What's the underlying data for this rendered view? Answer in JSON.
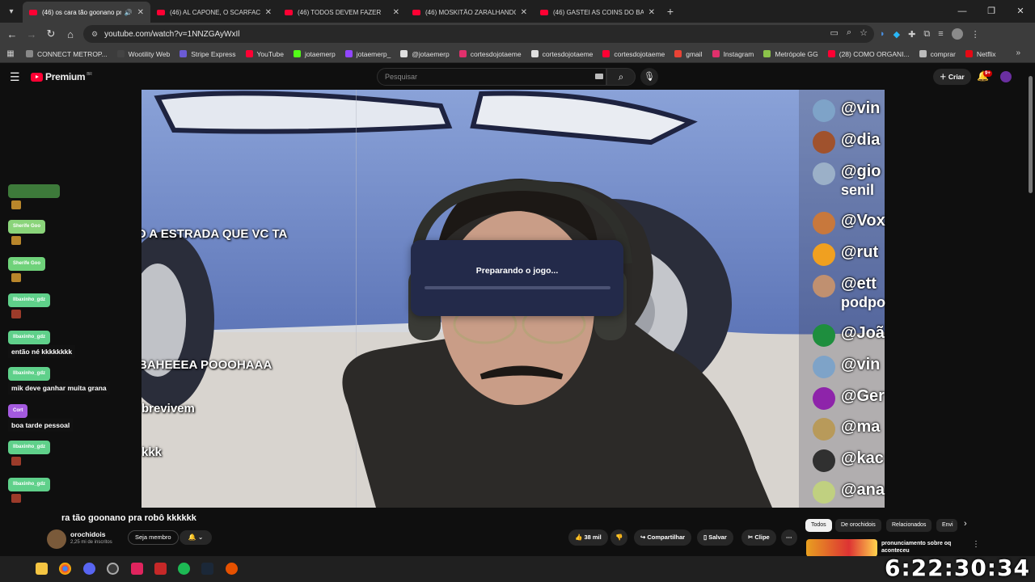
{
  "browser": {
    "tabs": [
      {
        "title": "(46) os cara tão goonano pr",
        "active": true
      },
      {
        "title": "(46) AL CAPONE, O SCARFACE",
        "active": false
      },
      {
        "title": "(46)  TODOS DEVEM FAZER",
        "active": false
      },
      {
        "title": "(46) MOSKITÃO ZARALHANDO",
        "active": false
      },
      {
        "title": "(46) GASTEI AS COINS DO BAN",
        "active": false
      }
    ],
    "url": "youtube.com/watch?v=1NNZGAyWxIl",
    "bookmarks": [
      {
        "label": "CONNECT METROP...",
        "color": "#888888"
      },
      {
        "label": "Wootility Web",
        "color": "#444444"
      },
      {
        "label": "Stripe Express",
        "color": "#6b5bd6"
      },
      {
        "label": "YouTube",
        "color": "#ff0033"
      },
      {
        "label": "jotaemerp",
        "color": "#53fc18"
      },
      {
        "label": "jotaemerp_",
        "color": "#9146ff"
      },
      {
        "label": "@jotaemerp",
        "color": "#e0e0e0"
      },
      {
        "label": "cortesdojotaeme",
        "color": "#e1306c"
      },
      {
        "label": "cortesdojotaeme",
        "color": "#e0e0e0"
      },
      {
        "label": "cortesdojotaeme",
        "color": "#ff0033"
      },
      {
        "label": "gmail",
        "color": "#ea4335"
      },
      {
        "label": "Instagram",
        "color": "#e1306c"
      },
      {
        "label": "Metrópole GG",
        "color": "#8bc34a"
      },
      {
        "label": "(28) COMO ORGANI...",
        "color": "#ff0033"
      },
      {
        "label": "comprar",
        "color": "#bbbbbb"
      },
      {
        "label": "Netflix",
        "color": "#e50914"
      }
    ]
  },
  "yt": {
    "logo": "Premium",
    "logo_sup": "BR",
    "search_placeholder": "Pesquisar",
    "create_label": "Criar",
    "notif_badge": "9+"
  },
  "video": {
    "captions": [
      "O A ESTRADA QUE VC TA",
      "BAHEEEA POOOHAAA",
      "brevivem",
      "kkk"
    ],
    "dialog_text": "Preparando o jogo...",
    "dialog_progress": 0,
    "overlay_chat": [
      {
        "name": "@vin",
        "sub": "",
        "color": "#7ea3c8"
      },
      {
        "name": "@dia",
        "sub": "",
        "color": "#a0522d"
      },
      {
        "name": "@gio",
        "sub": "senil",
        "color": "#9bb0c8"
      },
      {
        "name": "@Vox",
        "sub": "",
        "color": "#c8783c"
      },
      {
        "name": "@rut",
        "sub": "",
        "color": "#f0a020"
      },
      {
        "name": "@ett",
        "sub": "podpo",
        "color": "#c09070"
      },
      {
        "name": "@Joã",
        "sub": "",
        "color": "#1e8e3e"
      },
      {
        "name": "@vin",
        "sub": "",
        "color": "#7ea3c8"
      },
      {
        "name": "@Ger",
        "sub": "",
        "color": "#8e24aa"
      },
      {
        "name": "@ma",
        "sub": "",
        "color": "#b89a5a"
      },
      {
        "name": "@kac",
        "sub": "",
        "color": "#303030"
      },
      {
        "name": "@ana",
        "sub": "",
        "color": "#c0d080"
      }
    ]
  },
  "left_chat": [
    {
      "tag": "",
      "tag_color": "#3d7a3a",
      "msg": ""
    },
    {
      "tag": "Sherife Goo",
      "tag_color": "#8ad47a",
      "msg": ""
    },
    {
      "tag": "Sherife Goo",
      "tag_color": "#6fd27a",
      "msg": ""
    },
    {
      "tag": "Ilbaxinho_gdz",
      "tag_color": "#5fd08a",
      "msg": ""
    },
    {
      "tag": "Ilbaxinho_gdz",
      "tag_color": "#5fd08a",
      "msg": "então né kkkkkkkk"
    },
    {
      "tag": "Ilbaxinho_gdz",
      "tag_color": "#5fd08a",
      "msg": "mik deve ganhar muita grana"
    },
    {
      "tag": "Cort",
      "tag_color": "#a45adf",
      "msg": "boa tarde pessoal"
    },
    {
      "tag": "Ilbaxinho_gdz",
      "tag_color": "#5fd08a",
      "msg": ""
    },
    {
      "tag": "Ilbaxinho_gdz",
      "tag_color": "#5fd08a",
      "msg": ""
    },
    {
      "tag": "Ilbaxinho_gdz",
      "tag_color": "#5fd08a",
      "msg": ""
    },
    {
      "tag": "Ilbaxinho_gdz",
      "tag_color": "#5fd08a",
      "msg": ""
    }
  ],
  "below": {
    "title": "ra tão goonano pra robô kkkkkk",
    "channel": "orochidois",
    "subs": "2,25 mi de inscritos",
    "join": "Seja membro",
    "likes": "38 mil",
    "share": "Compartilhar",
    "save": "Salvar",
    "clip": "Clipe",
    "chips": [
      "Todos",
      "De orochidois",
      "Relacionados",
      "Envi"
    ],
    "rec_title": "pronunciamento sobre oq aconteceu"
  },
  "clock": "6:22:30:34"
}
